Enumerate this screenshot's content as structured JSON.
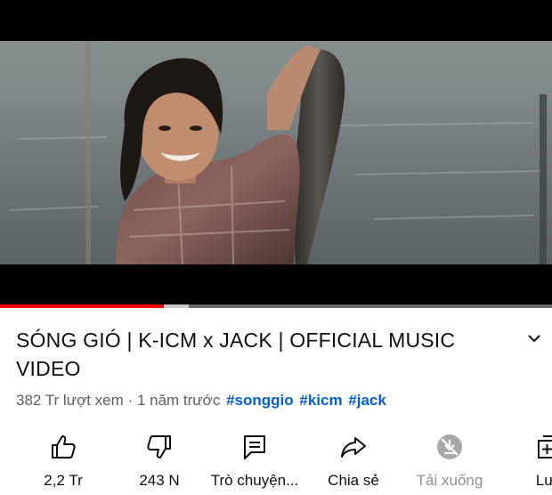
{
  "video": {
    "title": "SÓNG GIÓ | K-ICM x JACK | OFFICIAL MUSIC VIDEO",
    "views": "382 Tr lượt xem",
    "separator": "·",
    "age": "1 năm trước",
    "hashtags": [
      "#songgio",
      "#kicm",
      "#jack"
    ],
    "progress_fraction": 0.296,
    "buffered_fraction": 0.342
  },
  "actions": [
    {
      "label": "2,2 Tr",
      "icon": "thumbs-up-icon"
    },
    {
      "label": "243 N",
      "icon": "thumbs-down-icon"
    },
    {
      "label": "Trò chuyện...",
      "icon": "chat-icon"
    },
    {
      "label": "Chia sẻ",
      "icon": "share-icon"
    },
    {
      "label": "Tải xuống",
      "icon": "download-disabled-icon"
    },
    {
      "label": "Lưu",
      "icon": "save-to-playlist-icon"
    }
  ],
  "colors": {
    "progress_played": "#ff0000",
    "hashtag": "#065fd4",
    "meta_text": "#606060",
    "disabled": "#909090"
  }
}
